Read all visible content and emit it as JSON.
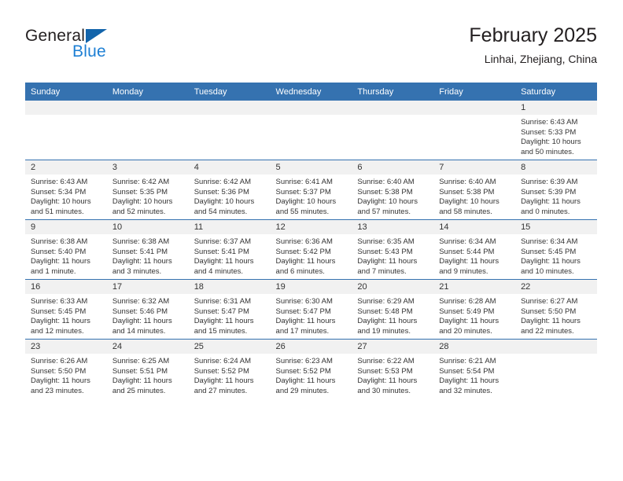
{
  "brand": {
    "name_top": "General",
    "name_bottom": "Blue",
    "triangle_color": "#1264ab",
    "blue_color": "#1d7fd4"
  },
  "header": {
    "title": "February 2025",
    "subtitle": "Linhai, Zhejiang, China"
  },
  "colors": {
    "header_row_bg": "#3572b0",
    "header_row_text": "#ffffff",
    "daynum_band_bg": "#f1f1f1",
    "grid_line": "#3572b0",
    "body_text": "#333333"
  },
  "weekdays": [
    "Sunday",
    "Monday",
    "Tuesday",
    "Wednesday",
    "Thursday",
    "Friday",
    "Saturday"
  ],
  "weeks": [
    [
      {
        "day": "",
        "sunrise": "",
        "sunset": "",
        "daylight": "",
        "daylight2": "",
        "empty": true
      },
      {
        "day": "",
        "sunrise": "",
        "sunset": "",
        "daylight": "",
        "daylight2": "",
        "empty": true
      },
      {
        "day": "",
        "sunrise": "",
        "sunset": "",
        "daylight": "",
        "daylight2": "",
        "empty": true
      },
      {
        "day": "",
        "sunrise": "",
        "sunset": "",
        "daylight": "",
        "daylight2": "",
        "empty": true
      },
      {
        "day": "",
        "sunrise": "",
        "sunset": "",
        "daylight": "",
        "daylight2": "",
        "empty": true
      },
      {
        "day": "",
        "sunrise": "",
        "sunset": "",
        "daylight": "",
        "daylight2": "",
        "empty": true
      },
      {
        "day": "1",
        "sunrise": "Sunrise: 6:43 AM",
        "sunset": "Sunset: 5:33 PM",
        "daylight": "Daylight: 10 hours",
        "daylight2": "and 50 minutes.",
        "empty": false
      }
    ],
    [
      {
        "day": "2",
        "sunrise": "Sunrise: 6:43 AM",
        "sunset": "Sunset: 5:34 PM",
        "daylight": "Daylight: 10 hours",
        "daylight2": "and 51 minutes.",
        "empty": false
      },
      {
        "day": "3",
        "sunrise": "Sunrise: 6:42 AM",
        "sunset": "Sunset: 5:35 PM",
        "daylight": "Daylight: 10 hours",
        "daylight2": "and 52 minutes.",
        "empty": false
      },
      {
        "day": "4",
        "sunrise": "Sunrise: 6:42 AM",
        "sunset": "Sunset: 5:36 PM",
        "daylight": "Daylight: 10 hours",
        "daylight2": "and 54 minutes.",
        "empty": false
      },
      {
        "day": "5",
        "sunrise": "Sunrise: 6:41 AM",
        "sunset": "Sunset: 5:37 PM",
        "daylight": "Daylight: 10 hours",
        "daylight2": "and 55 minutes.",
        "empty": false
      },
      {
        "day": "6",
        "sunrise": "Sunrise: 6:40 AM",
        "sunset": "Sunset: 5:38 PM",
        "daylight": "Daylight: 10 hours",
        "daylight2": "and 57 minutes.",
        "empty": false
      },
      {
        "day": "7",
        "sunrise": "Sunrise: 6:40 AM",
        "sunset": "Sunset: 5:38 PM",
        "daylight": "Daylight: 10 hours",
        "daylight2": "and 58 minutes.",
        "empty": false
      },
      {
        "day": "8",
        "sunrise": "Sunrise: 6:39 AM",
        "sunset": "Sunset: 5:39 PM",
        "daylight": "Daylight: 11 hours",
        "daylight2": "and 0 minutes.",
        "empty": false
      }
    ],
    [
      {
        "day": "9",
        "sunrise": "Sunrise: 6:38 AM",
        "sunset": "Sunset: 5:40 PM",
        "daylight": "Daylight: 11 hours",
        "daylight2": "and 1 minute.",
        "empty": false
      },
      {
        "day": "10",
        "sunrise": "Sunrise: 6:38 AM",
        "sunset": "Sunset: 5:41 PM",
        "daylight": "Daylight: 11 hours",
        "daylight2": "and 3 minutes.",
        "empty": false
      },
      {
        "day": "11",
        "sunrise": "Sunrise: 6:37 AM",
        "sunset": "Sunset: 5:41 PM",
        "daylight": "Daylight: 11 hours",
        "daylight2": "and 4 minutes.",
        "empty": false
      },
      {
        "day": "12",
        "sunrise": "Sunrise: 6:36 AM",
        "sunset": "Sunset: 5:42 PM",
        "daylight": "Daylight: 11 hours",
        "daylight2": "and 6 minutes.",
        "empty": false
      },
      {
        "day": "13",
        "sunrise": "Sunrise: 6:35 AM",
        "sunset": "Sunset: 5:43 PM",
        "daylight": "Daylight: 11 hours",
        "daylight2": "and 7 minutes.",
        "empty": false
      },
      {
        "day": "14",
        "sunrise": "Sunrise: 6:34 AM",
        "sunset": "Sunset: 5:44 PM",
        "daylight": "Daylight: 11 hours",
        "daylight2": "and 9 minutes.",
        "empty": false
      },
      {
        "day": "15",
        "sunrise": "Sunrise: 6:34 AM",
        "sunset": "Sunset: 5:45 PM",
        "daylight": "Daylight: 11 hours",
        "daylight2": "and 10 minutes.",
        "empty": false
      }
    ],
    [
      {
        "day": "16",
        "sunrise": "Sunrise: 6:33 AM",
        "sunset": "Sunset: 5:45 PM",
        "daylight": "Daylight: 11 hours",
        "daylight2": "and 12 minutes.",
        "empty": false
      },
      {
        "day": "17",
        "sunrise": "Sunrise: 6:32 AM",
        "sunset": "Sunset: 5:46 PM",
        "daylight": "Daylight: 11 hours",
        "daylight2": "and 14 minutes.",
        "empty": false
      },
      {
        "day": "18",
        "sunrise": "Sunrise: 6:31 AM",
        "sunset": "Sunset: 5:47 PM",
        "daylight": "Daylight: 11 hours",
        "daylight2": "and 15 minutes.",
        "empty": false
      },
      {
        "day": "19",
        "sunrise": "Sunrise: 6:30 AM",
        "sunset": "Sunset: 5:47 PM",
        "daylight": "Daylight: 11 hours",
        "daylight2": "and 17 minutes.",
        "empty": false
      },
      {
        "day": "20",
        "sunrise": "Sunrise: 6:29 AM",
        "sunset": "Sunset: 5:48 PM",
        "daylight": "Daylight: 11 hours",
        "daylight2": "and 19 minutes.",
        "empty": false
      },
      {
        "day": "21",
        "sunrise": "Sunrise: 6:28 AM",
        "sunset": "Sunset: 5:49 PM",
        "daylight": "Daylight: 11 hours",
        "daylight2": "and 20 minutes.",
        "empty": false
      },
      {
        "day": "22",
        "sunrise": "Sunrise: 6:27 AM",
        "sunset": "Sunset: 5:50 PM",
        "daylight": "Daylight: 11 hours",
        "daylight2": "and 22 minutes.",
        "empty": false
      }
    ],
    [
      {
        "day": "23",
        "sunrise": "Sunrise: 6:26 AM",
        "sunset": "Sunset: 5:50 PM",
        "daylight": "Daylight: 11 hours",
        "daylight2": "and 23 minutes.",
        "empty": false
      },
      {
        "day": "24",
        "sunrise": "Sunrise: 6:25 AM",
        "sunset": "Sunset: 5:51 PM",
        "daylight": "Daylight: 11 hours",
        "daylight2": "and 25 minutes.",
        "empty": false
      },
      {
        "day": "25",
        "sunrise": "Sunrise: 6:24 AM",
        "sunset": "Sunset: 5:52 PM",
        "daylight": "Daylight: 11 hours",
        "daylight2": "and 27 minutes.",
        "empty": false
      },
      {
        "day": "26",
        "sunrise": "Sunrise: 6:23 AM",
        "sunset": "Sunset: 5:52 PM",
        "daylight": "Daylight: 11 hours",
        "daylight2": "and 29 minutes.",
        "empty": false
      },
      {
        "day": "27",
        "sunrise": "Sunrise: 6:22 AM",
        "sunset": "Sunset: 5:53 PM",
        "daylight": "Daylight: 11 hours",
        "daylight2": "and 30 minutes.",
        "empty": false
      },
      {
        "day": "28",
        "sunrise": "Sunrise: 6:21 AM",
        "sunset": "Sunset: 5:54 PM",
        "daylight": "Daylight: 11 hours",
        "daylight2": "and 32 minutes.",
        "empty": false
      },
      {
        "day": "",
        "sunrise": "",
        "sunset": "",
        "daylight": "",
        "daylight2": "",
        "empty": true
      }
    ]
  ]
}
